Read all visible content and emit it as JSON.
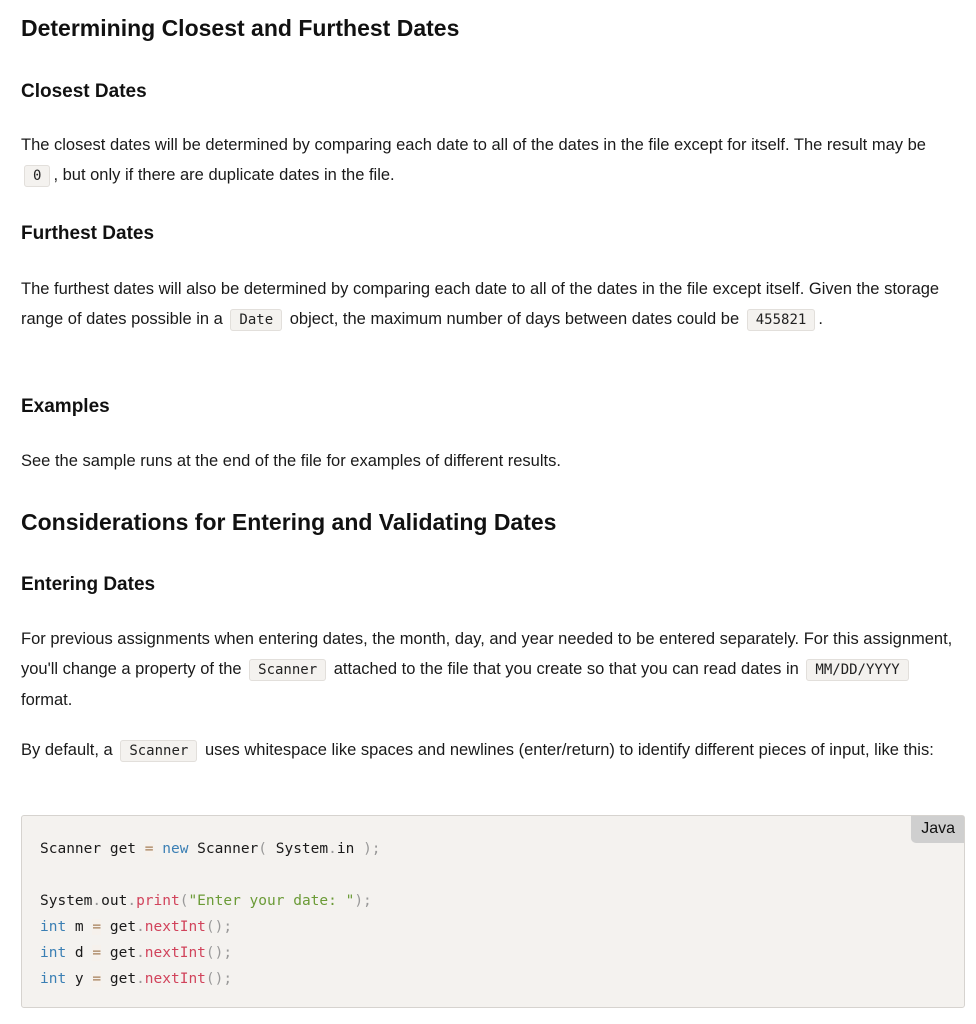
{
  "sections": {
    "closest_furthest": {
      "heading": "Determining Closest and Furthest Dates",
      "closest": {
        "heading": "Closest Dates",
        "p1_a": "The closest dates will be determined by comparing each date to all of the dates in the file except for itself. The result may be",
        "p1_code": "0",
        "p1_b": ", but only if there are duplicate dates in the file."
      },
      "furthest": {
        "heading": "Furthest Dates",
        "p1_a": "The furthest dates will also be determined by comparing each date to all of the dates in the file except itself. Given the storage range of dates possible in a",
        "p1_code1": "Date",
        "p1_b": "object, the maximum number of days between dates could be",
        "p1_code2": "455821",
        "p1_c": "."
      },
      "examples": {
        "heading": "Examples",
        "text": "See the sample runs at the end of the file for examples of different results."
      }
    },
    "considerations": {
      "heading": "Considerations for Entering and Validating Dates",
      "entering": {
        "heading": "Entering Dates",
        "p1_a": "For previous assignments when entering dates, the month, day, and year needed to be entered separately. For this assignment, you'll change a property of the",
        "p1_code1": "Scanner",
        "p1_b": "attached to the file that you create so that you can read dates in",
        "p1_code2": "MM/DD/YYYY",
        "p1_c": "format.",
        "p2_a": "By default, a",
        "p2_code": "Scanner",
        "p2_b": "uses whitespace like spaces and newlines (enter/return) to identify different pieces of input, like this:"
      }
    }
  },
  "code_block": {
    "language": "Java",
    "lines": [
      [
        {
          "t": "Scanner get ",
          "c": "plain"
        },
        {
          "t": "=",
          "c": "op"
        },
        {
          "t": " ",
          "c": "plain"
        },
        {
          "t": "new",
          "c": "kw"
        },
        {
          "t": " Scanner",
          "c": "plain"
        },
        {
          "t": "(",
          "c": "punc"
        },
        {
          "t": " System",
          "c": "plain"
        },
        {
          "t": ".",
          "c": "punc"
        },
        {
          "t": "in ",
          "c": "plain"
        },
        {
          "t": ");",
          "c": "punc"
        }
      ],
      [],
      [
        {
          "t": "System",
          "c": "plain"
        },
        {
          "t": ".",
          "c": "punc"
        },
        {
          "t": "out",
          "c": "plain"
        },
        {
          "t": ".",
          "c": "punc"
        },
        {
          "t": "print",
          "c": "fn"
        },
        {
          "t": "(",
          "c": "punc"
        },
        {
          "t": "\"Enter your date: \"",
          "c": "str"
        },
        {
          "t": ");",
          "c": "punc"
        }
      ],
      [
        {
          "t": "int",
          "c": "kw"
        },
        {
          "t": " m ",
          "c": "plain"
        },
        {
          "t": "=",
          "c": "op"
        },
        {
          "t": " get",
          "c": "plain"
        },
        {
          "t": ".",
          "c": "punc"
        },
        {
          "t": "nextInt",
          "c": "fn"
        },
        {
          "t": "();",
          "c": "punc"
        }
      ],
      [
        {
          "t": "int",
          "c": "kw"
        },
        {
          "t": " d ",
          "c": "plain"
        },
        {
          "t": "=",
          "c": "op"
        },
        {
          "t": " get",
          "c": "plain"
        },
        {
          "t": ".",
          "c": "punc"
        },
        {
          "t": "nextInt",
          "c": "fn"
        },
        {
          "t": "();",
          "c": "punc"
        }
      ],
      [
        {
          "t": "int",
          "c": "kw"
        },
        {
          "t": " y ",
          "c": "plain"
        },
        {
          "t": "=",
          "c": "op"
        },
        {
          "t": " get",
          "c": "plain"
        },
        {
          "t": ".",
          "c": "punc"
        },
        {
          "t": "nextInt",
          "c": "fn"
        },
        {
          "t": "();",
          "c": "punc"
        }
      ]
    ]
  }
}
